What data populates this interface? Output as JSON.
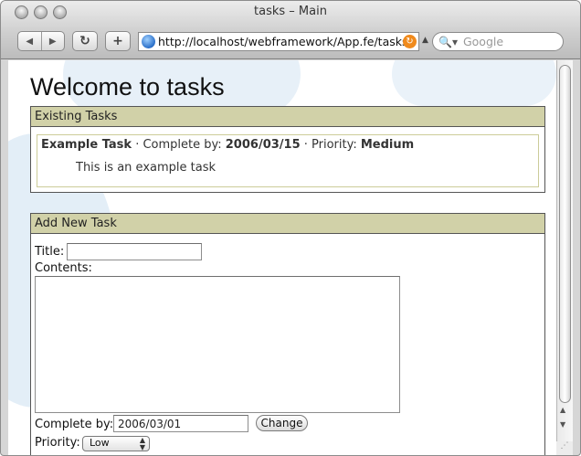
{
  "window": {
    "title": "tasks – Main"
  },
  "toolbar": {
    "url": "http://localhost/webframework/App.fe/tasks/",
    "search_placeholder": "Google"
  },
  "page": {
    "title": "Welcome to tasks",
    "existing": {
      "heading": "Existing Tasks",
      "tasks": [
        {
          "name": "Example Task",
          "complete_label": "Complete by:",
          "complete_by": "2006/03/15",
          "priority_label": "Priority:",
          "priority": "Medium",
          "description": "This is an example task"
        }
      ]
    },
    "add_new": {
      "heading": "Add New Task",
      "title_label": "Title:",
      "title_value": "",
      "contents_label": "Contents:",
      "contents_value": "",
      "complete_label": "Complete by:",
      "complete_value": "2006/03/01",
      "change_label": "Change",
      "priority_label": "Priority:",
      "priority_value": "Low"
    }
  }
}
